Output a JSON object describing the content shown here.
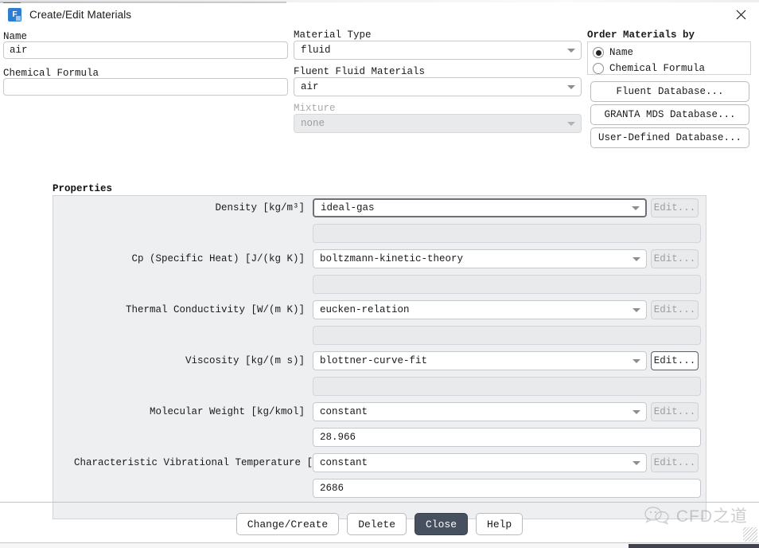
{
  "window": {
    "title": "Create/Edit Materials",
    "app_icon": "fluent-app-icon",
    "close_icon": "close-icon"
  },
  "left": {
    "name_label": "Name",
    "name_value": "air",
    "chemical_formula_label": "Chemical Formula",
    "chemical_formula_value": ""
  },
  "middle": {
    "material_type_label": "Material Type",
    "material_type_value": "fluid",
    "fluent_fluid_materials_label": "Fluent Fluid Materials",
    "fluent_fluid_materials_value": "air",
    "mixture_label": "Mixture",
    "mixture_value": "none"
  },
  "right": {
    "order_by_label": "Order Materials by",
    "options": [
      {
        "label": "Name",
        "selected": true
      },
      {
        "label": "Chemical Formula",
        "selected": false
      }
    ],
    "buttons": [
      "Fluent Database...",
      "GRANTA MDS Database...",
      "User-Defined Database..."
    ]
  },
  "properties": {
    "title": "Properties",
    "rows": [
      {
        "label": "Density [kg/m³]",
        "method": "ideal-gas",
        "value": "",
        "edit_label": "Edit...",
        "edit_enabled": false,
        "value_editable": false,
        "focused": true
      },
      {
        "label": "Cp (Specific Heat) [J/(kg K)]",
        "method": "boltzmann-kinetic-theory",
        "value": "",
        "edit_label": "Edit...",
        "edit_enabled": false,
        "value_editable": false,
        "focused": false
      },
      {
        "label": "Thermal Conductivity [W/(m K)]",
        "method": "eucken-relation",
        "value": "",
        "edit_label": "Edit...",
        "edit_enabled": false,
        "value_editable": false,
        "focused": false
      },
      {
        "label": "Viscosity [kg/(m s)]",
        "method": "blottner-curve-fit",
        "value": "",
        "edit_label": "Edit...",
        "edit_enabled": true,
        "value_editable": false,
        "focused": false
      },
      {
        "label": "Molecular Weight [kg/kmol]",
        "method": "constant",
        "value": "28.966",
        "edit_label": "Edit...",
        "edit_enabled": false,
        "value_editable": true,
        "focused": false
      },
      {
        "label": "Characteristic Vibrational Temperature [K]",
        "method": "constant",
        "value": "2686",
        "edit_label": "Edit...",
        "edit_enabled": false,
        "value_editable": true,
        "focused": false
      }
    ]
  },
  "footer": {
    "buttons": [
      {
        "label": "Change/Create",
        "primary": false
      },
      {
        "label": "Delete",
        "primary": false
      },
      {
        "label": "Close",
        "primary": true
      },
      {
        "label": "Help",
        "primary": false
      }
    ]
  },
  "watermark": {
    "text": "CFD之道",
    "icon": "wechat-bubble-icon"
  },
  "colors": {
    "accent": "#2d7dd2",
    "primary_button": "#46505f",
    "panel": "#eeeff1",
    "disabled_text": "#9a9ca1"
  }
}
